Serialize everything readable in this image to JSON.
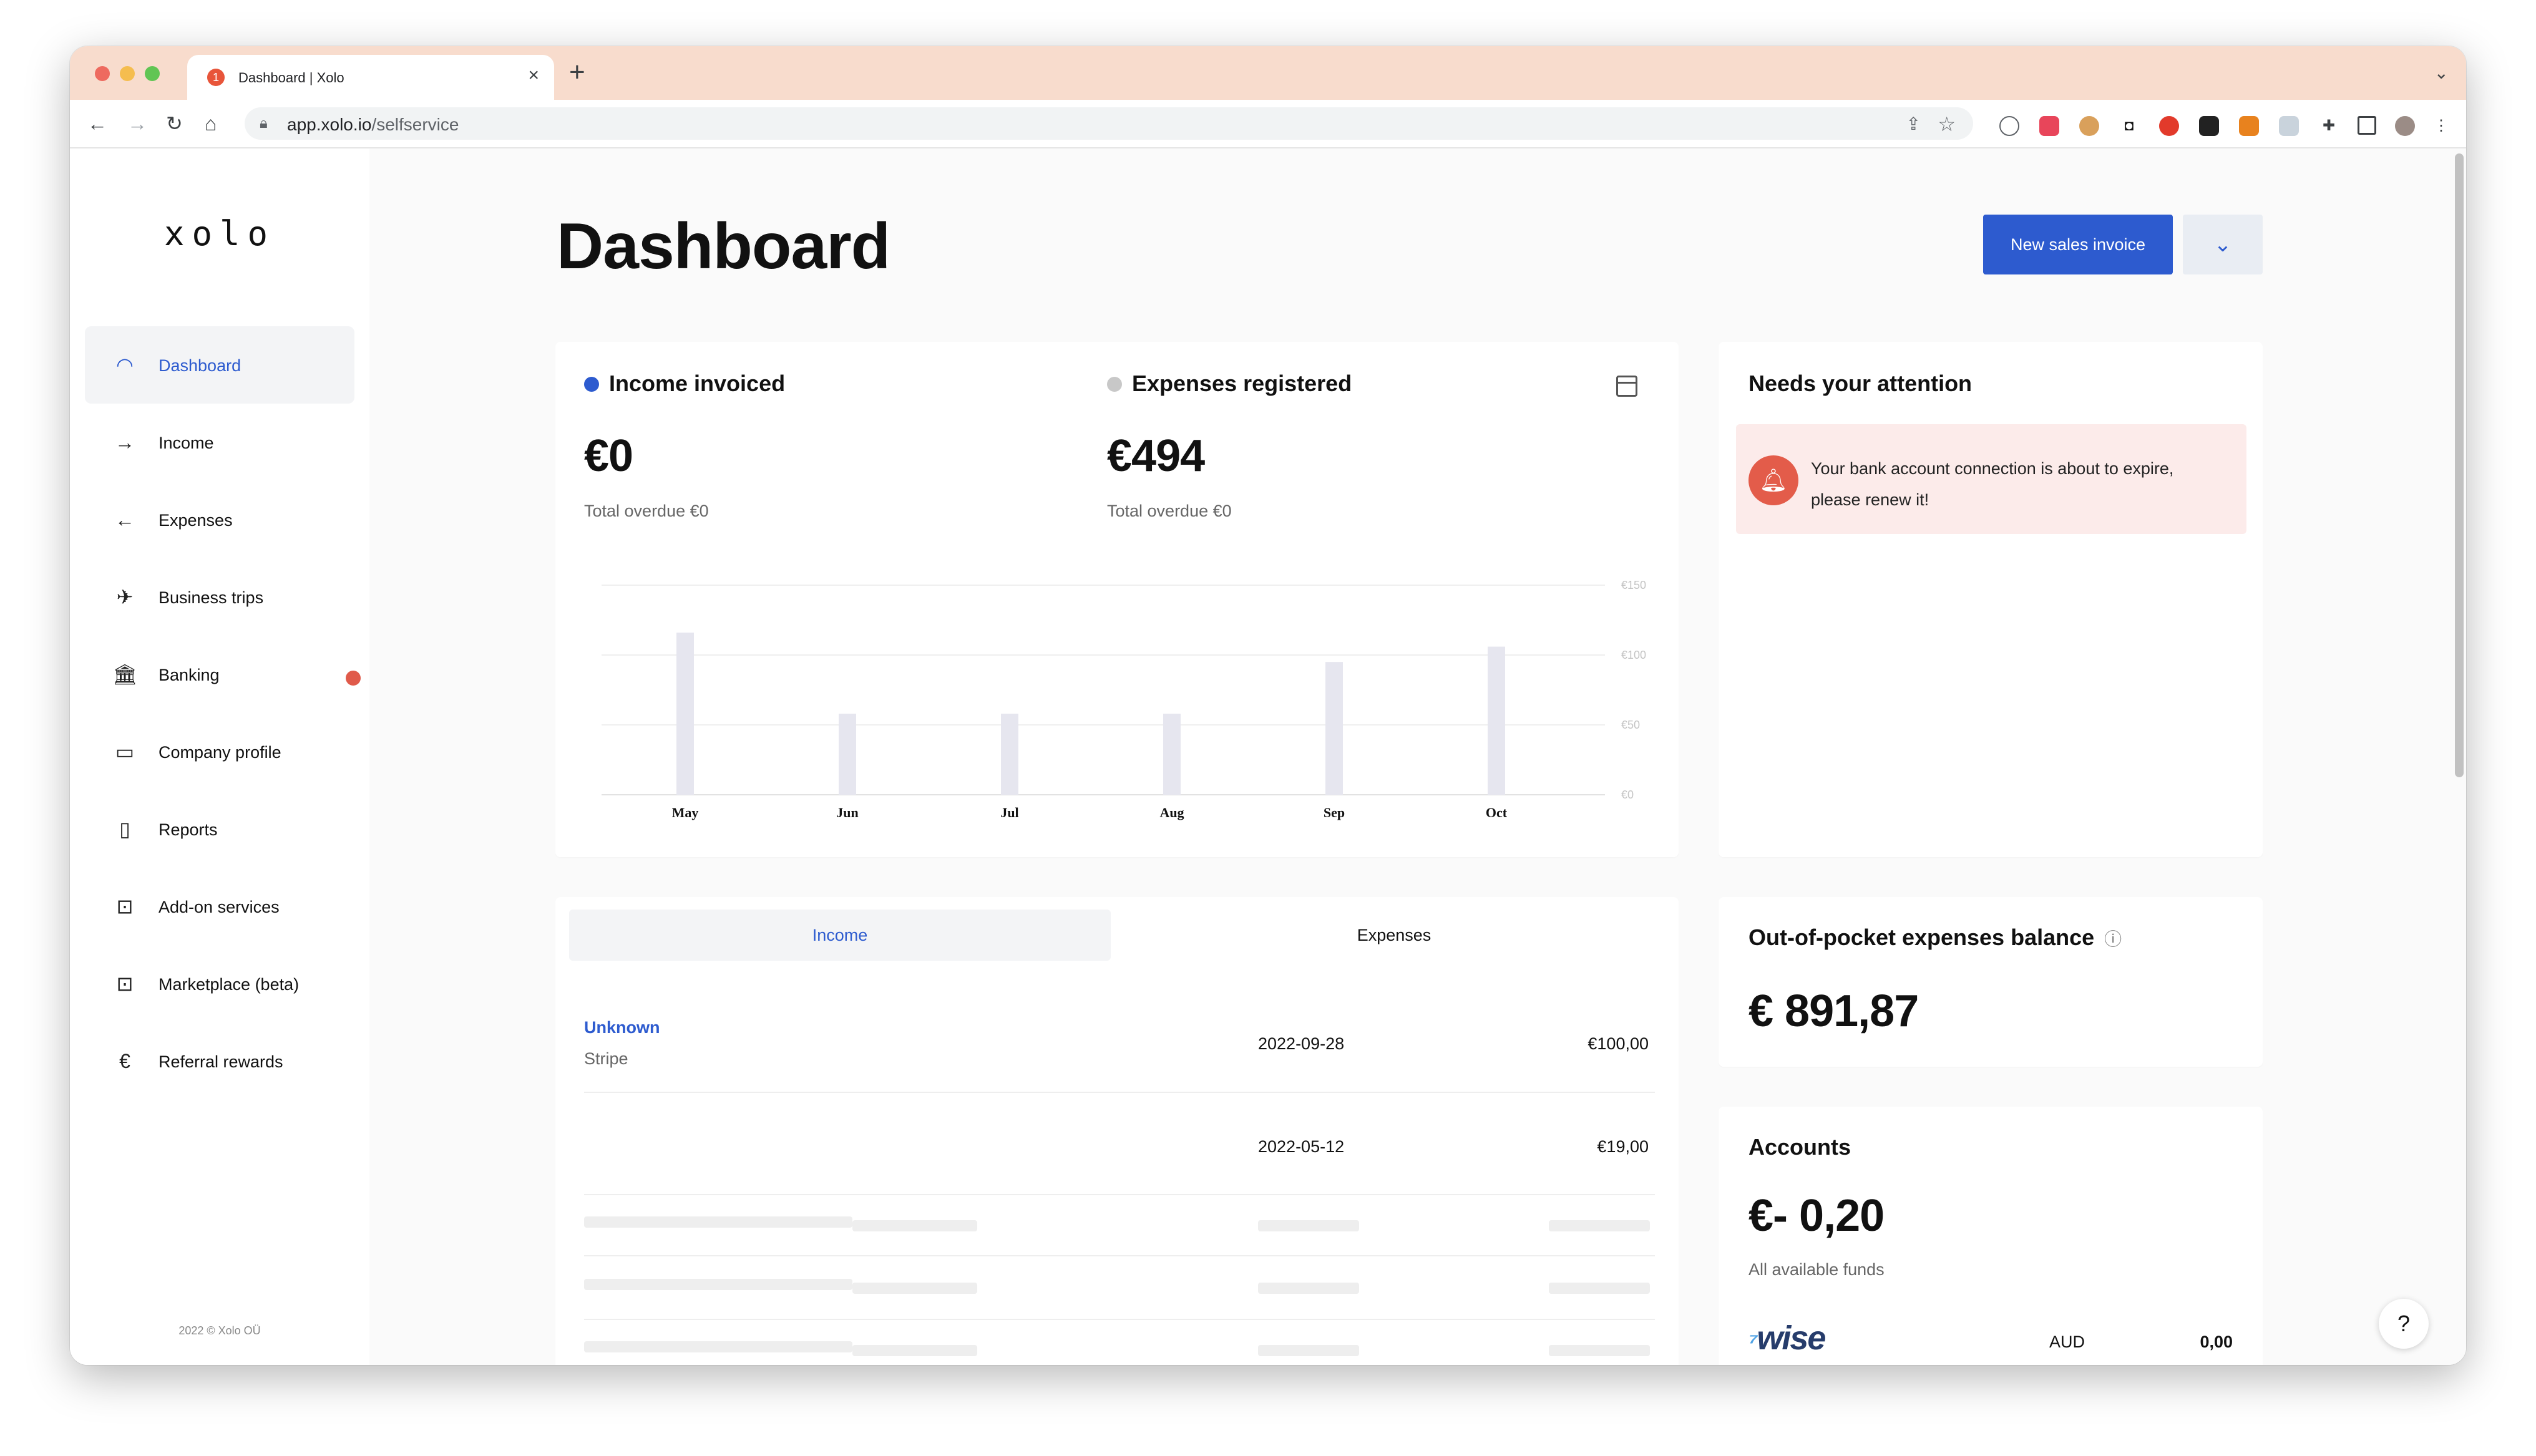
{
  "browser": {
    "tab_title": "Dashboard | Xolo",
    "tab_badge": "1",
    "url_host": "app.xolo.io",
    "url_path": "/selfservice"
  },
  "sidebar": {
    "logo": "xolo",
    "items": [
      {
        "label": "Dashboard",
        "icon": "dashboard-gauge-icon",
        "active": true
      },
      {
        "label": "Income",
        "icon": "arrow-right-icon"
      },
      {
        "label": "Expenses",
        "icon": "arrow-left-icon"
      },
      {
        "label": "Business trips",
        "icon": "airplane-icon"
      },
      {
        "label": "Banking",
        "icon": "bank-icon",
        "notification": true
      },
      {
        "label": "Company profile",
        "icon": "briefcase-icon"
      },
      {
        "label": "Reports",
        "icon": "document-icon"
      },
      {
        "label": "Add-on services",
        "icon": "inbox-box-icon"
      },
      {
        "label": "Marketplace (beta)",
        "icon": "inbox-box-icon"
      },
      {
        "label": "Referral rewards",
        "icon": "euro-icon"
      }
    ],
    "copyright": "2022 © Xolo OÜ"
  },
  "header": {
    "title": "Dashboard",
    "primary_button": "New sales invoice"
  },
  "summary": {
    "income_label": "Income invoiced",
    "income_value": "€0",
    "income_overdue": "Total overdue €0",
    "expenses_label": "Expenses registered",
    "expenses_value": "€494",
    "expenses_overdue": "Total overdue €0",
    "income_color": "#2d5bcf",
    "expenses_color": "#c8c8c8"
  },
  "chart_data": {
    "type": "bar",
    "categories": [
      "May",
      "Jun",
      "Jul",
      "Aug",
      "Sep",
      "Oct"
    ],
    "series": [
      {
        "values": [
          0,
          0,
          0,
          0,
          0,
          0
        ]
      },
      {
        "values": [
          116,
          58,
          58,
          58,
          95,
          106
        ]
      }
    ],
    "yticks": [
      "€0",
      "€50",
      "€100",
      "€150"
    ],
    "ylim": [
      0,
      150
    ],
    "grid": true,
    "bar_color": "#e6e6ef"
  },
  "transactions": {
    "tabs": [
      "Income",
      "Expenses"
    ],
    "active_tab": "Income",
    "rows": [
      {
        "name": "Unknown",
        "source": "Stripe",
        "date": "2022-09-28",
        "amount": "€100,00"
      },
      {
        "name": "",
        "source": "",
        "date": "2022-05-12",
        "amount": "€19,00"
      }
    ]
  },
  "attention": {
    "title": "Needs your attention",
    "message": "Your bank account connection is about to expire, please renew it!"
  },
  "out_of_pocket": {
    "title": "Out-of-pocket expenses balance",
    "value": "€ 891,87"
  },
  "accounts": {
    "title": "Accounts",
    "total": "€- 0,20",
    "total_label": "All available funds",
    "bank": "wise",
    "currency": "AUD",
    "balance": "0,00"
  },
  "help": {
    "label": "?"
  }
}
